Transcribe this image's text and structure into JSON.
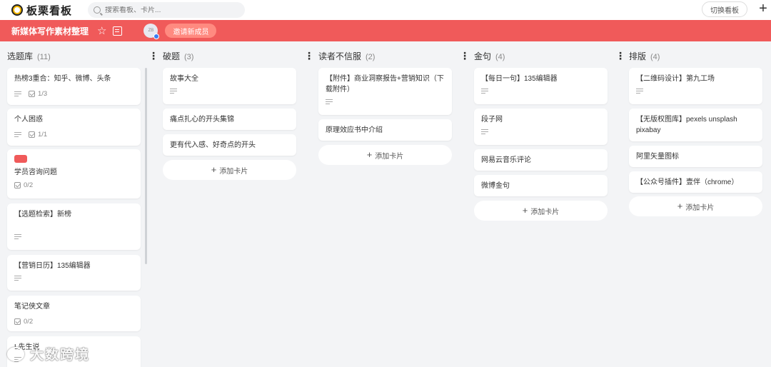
{
  "app": {
    "name": "板栗看板"
  },
  "search": {
    "placeholder": "搜索看板、卡片..."
  },
  "header": {
    "switch_label": "切换看板",
    "add_symbol": "+"
  },
  "board": {
    "title": "新媒体写作素材整理",
    "avatar_text": "ZB",
    "invite_label": "邀请新成员"
  },
  "add_card_label": "添加卡片",
  "columns": [
    {
      "title": "选题库",
      "count": "(11)",
      "cards": [
        {
          "title": "热榜3重合：知乎、微博、头条",
          "lines": true,
          "checklist": "1/3"
        },
        {
          "title": "个人困惑",
          "lines": true,
          "checklist": "1/1"
        },
        {
          "title": "学员咨询问题",
          "label": true,
          "checklist": "0/2"
        },
        {
          "title": "【选题检索】新榜",
          "lines": true
        },
        {
          "title": "【营销日历】135编辑器",
          "lines": true
        },
        {
          "title": "笔记侠文章",
          "checklist": "0/2"
        },
        {
          "title": "L先生说",
          "lines": true
        }
      ]
    },
    {
      "title": "破题",
      "count": "(3)",
      "cards": [
        {
          "title": "故事大全",
          "lines": true
        },
        {
          "title": "痛点扎心的开头集锦"
        },
        {
          "title": "更有代入感、好奇点的开头"
        }
      ]
    },
    {
      "title": "读者不信服",
      "count": "(2)",
      "cards": [
        {
          "title": "【附件】商业洞察报告+营销知识（下载附件）",
          "lines": true
        },
        {
          "title": "原理效应书中介绍"
        }
      ]
    },
    {
      "title": "金句",
      "count": "(4)",
      "cards": [
        {
          "title": "【每日一句】135编辑器",
          "lines": true
        },
        {
          "title": "段子网",
          "lines": true
        },
        {
          "title": "网易云音乐评论"
        },
        {
          "title": "微博金句"
        }
      ]
    },
    {
      "title": "排版",
      "count": "(4)",
      "cards": [
        {
          "title": "【二维码设计】第九工场",
          "lines": true
        },
        {
          "title": "【无版权图库】pexels unsplash pixabay"
        },
        {
          "title": "阿里矢量图标"
        },
        {
          "title": "【公众号插件】壹伴（chrome）"
        }
      ]
    }
  ],
  "watermark": {
    "text": "大数跨境"
  }
}
